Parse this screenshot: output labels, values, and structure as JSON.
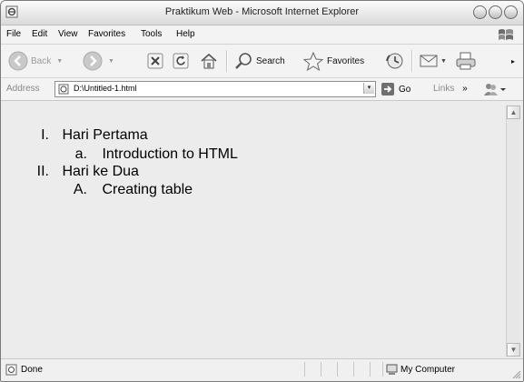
{
  "window": {
    "title": "Praktikum Web - Microsoft Internet Explorer"
  },
  "menu": [
    "File",
    "Edit",
    "View",
    "Favorites",
    "Tools",
    "Help"
  ],
  "toolbar": {
    "back_label": "Back",
    "search_label": "Search",
    "favorites_label": "Favorites"
  },
  "address": {
    "label": "Address",
    "value": "D:\\Untitled-1.html",
    "go_label": "Go",
    "links_label": "Links"
  },
  "content": {
    "items": [
      {
        "marker": "I.",
        "text": "Hari Pertama",
        "sub": [
          {
            "marker": "a.",
            "text": "Introduction to HTML"
          }
        ]
      },
      {
        "marker": "II.",
        "text": "Hari ke Dua",
        "sub": [
          {
            "marker": "A.",
            "text": "Creating table"
          }
        ]
      }
    ]
  },
  "status": {
    "text": "Done",
    "zone": "My Computer"
  }
}
